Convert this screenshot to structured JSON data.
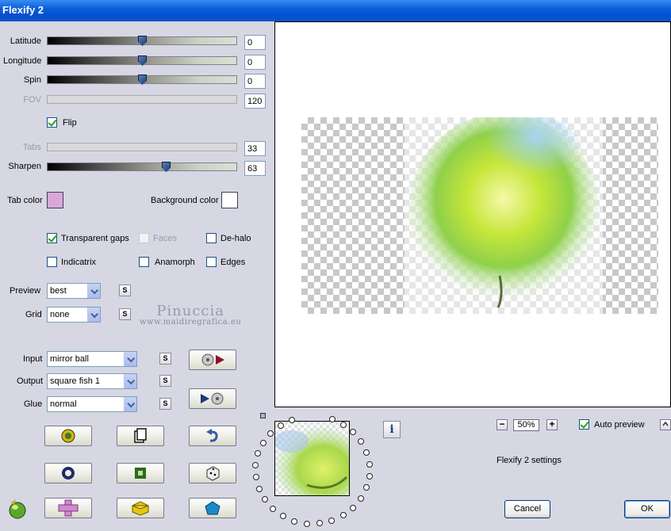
{
  "window": {
    "title": "Flexify 2"
  },
  "sliders": {
    "latitude": {
      "label": "Latitude",
      "value": "0",
      "position": 0.5
    },
    "longitude": {
      "label": "Longitude",
      "value": "0",
      "position": 0.5
    },
    "spin": {
      "label": "Spin",
      "value": "0",
      "position": 0.5
    },
    "fov": {
      "label": "FOV",
      "value": "120",
      "disabled": true
    },
    "tabs": {
      "label": "Tabs",
      "value": "33",
      "disabled": true
    },
    "sharpen": {
      "label": "Sharpen",
      "value": "63",
      "position": 0.63
    }
  },
  "flip": {
    "label": "Flip",
    "checked": true
  },
  "colors": {
    "tab_color_label": "Tab color",
    "tab_color": "#d9a8d9",
    "background_color_label": "Background color",
    "background_color": "#ffffff"
  },
  "options": {
    "transparent_gaps": {
      "label": "Transparent gaps",
      "checked": true
    },
    "faces": {
      "label": "Faces",
      "checked": false,
      "disabled": true
    },
    "de_halo": {
      "label": "De-halo",
      "checked": false
    },
    "indicatrix": {
      "label": "Indicatrix",
      "checked": false
    },
    "anamorph": {
      "label": "Anamorph",
      "checked": false
    },
    "edges": {
      "label": "Edges",
      "checked": false
    }
  },
  "preview_quality": {
    "label": "Preview",
    "value": "best"
  },
  "grid": {
    "label": "Grid",
    "value": "none"
  },
  "projection": {
    "input": {
      "label": "Input",
      "value": "mirror ball"
    },
    "output": {
      "label": "Output",
      "value": "square fish 1"
    },
    "glue": {
      "label": "Glue",
      "value": "normal"
    }
  },
  "sbutton": "S",
  "watermark": {
    "line1": "Pinuccia",
    "line2": "www.maidiregrafica.eu"
  },
  "zoom": {
    "minus": "−",
    "value": "50%",
    "plus": "+"
  },
  "auto_preview": {
    "label": "Auto preview",
    "checked": true
  },
  "settings_caption": "Flexify 2 settings",
  "buttons": {
    "cancel": "Cancel",
    "ok": "OK"
  },
  "accent": "#0a5fd8"
}
